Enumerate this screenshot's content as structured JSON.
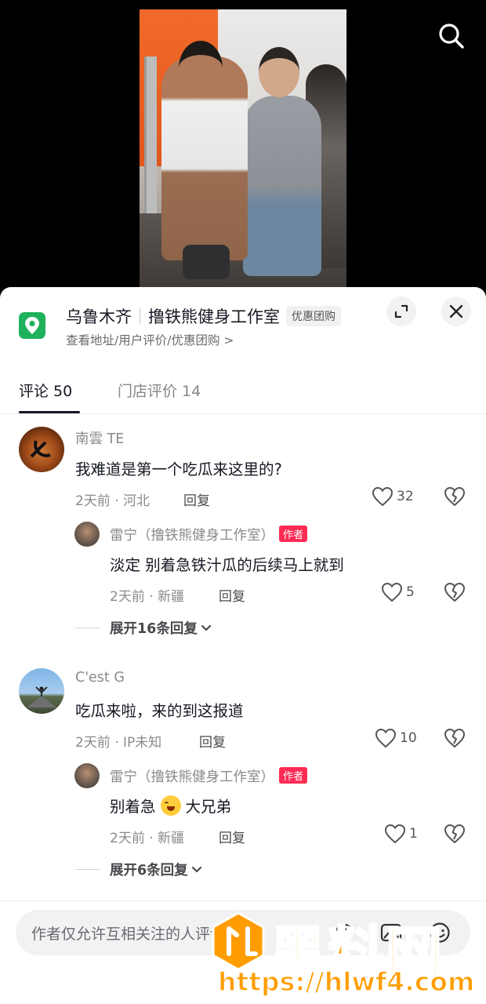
{
  "video": {
    "label": "gym video frame"
  },
  "search": {
    "icon": "search-icon"
  },
  "store": {
    "city": "乌鲁木齐",
    "name": "撸铁熊健身工作室",
    "badge": "优惠团购",
    "sublinks": "查看地址/用户评价/优惠团购 >",
    "accent": "#1fb15b"
  },
  "tabs": [
    {
      "label": "评论 50",
      "active": true
    },
    {
      "label": "门店评价 14",
      "active": false
    }
  ],
  "comments": [
    {
      "user": "南雲 TE",
      "text": "我难道是第一个吃瓜来这里的?",
      "meta": "2天前 · 河北",
      "reply": "回复",
      "likes": "32",
      "replies": [
        {
          "user": "雷宁（撸铁熊健身工作室）",
          "badge": "作者",
          "text": "淡定 别着急铁汁瓜的后续马上就到",
          "meta": "2天前 · 新疆",
          "reply": "回复",
          "likes": "5"
        }
      ],
      "expand": "展开16条回复"
    },
    {
      "user": "C'est G",
      "text": "吃瓜来啦，来的到这报道",
      "meta": "2天前 · IP未知",
      "reply": "回复",
      "likes": "10",
      "replies": [
        {
          "user": "雷宁（撸铁熊健身工作室）",
          "badge": "作者",
          "text_before": "别着急",
          "emoji": "laughing-tears-emoji",
          "text_after": "大兄弟",
          "meta": "2天前 · 新疆",
          "reply": "回复",
          "likes": "1"
        }
      ],
      "expand": "展开6条回复"
    }
  ],
  "input": {
    "placeholder": "作者仅允许互相关注的人评论",
    "icons": [
      "at-icon",
      "image-icon",
      "emoji-icon"
    ]
  },
  "watermark": {
    "brand": "黑料网",
    "url": "https://hlwf4.com",
    "color": "#ff9d00"
  }
}
